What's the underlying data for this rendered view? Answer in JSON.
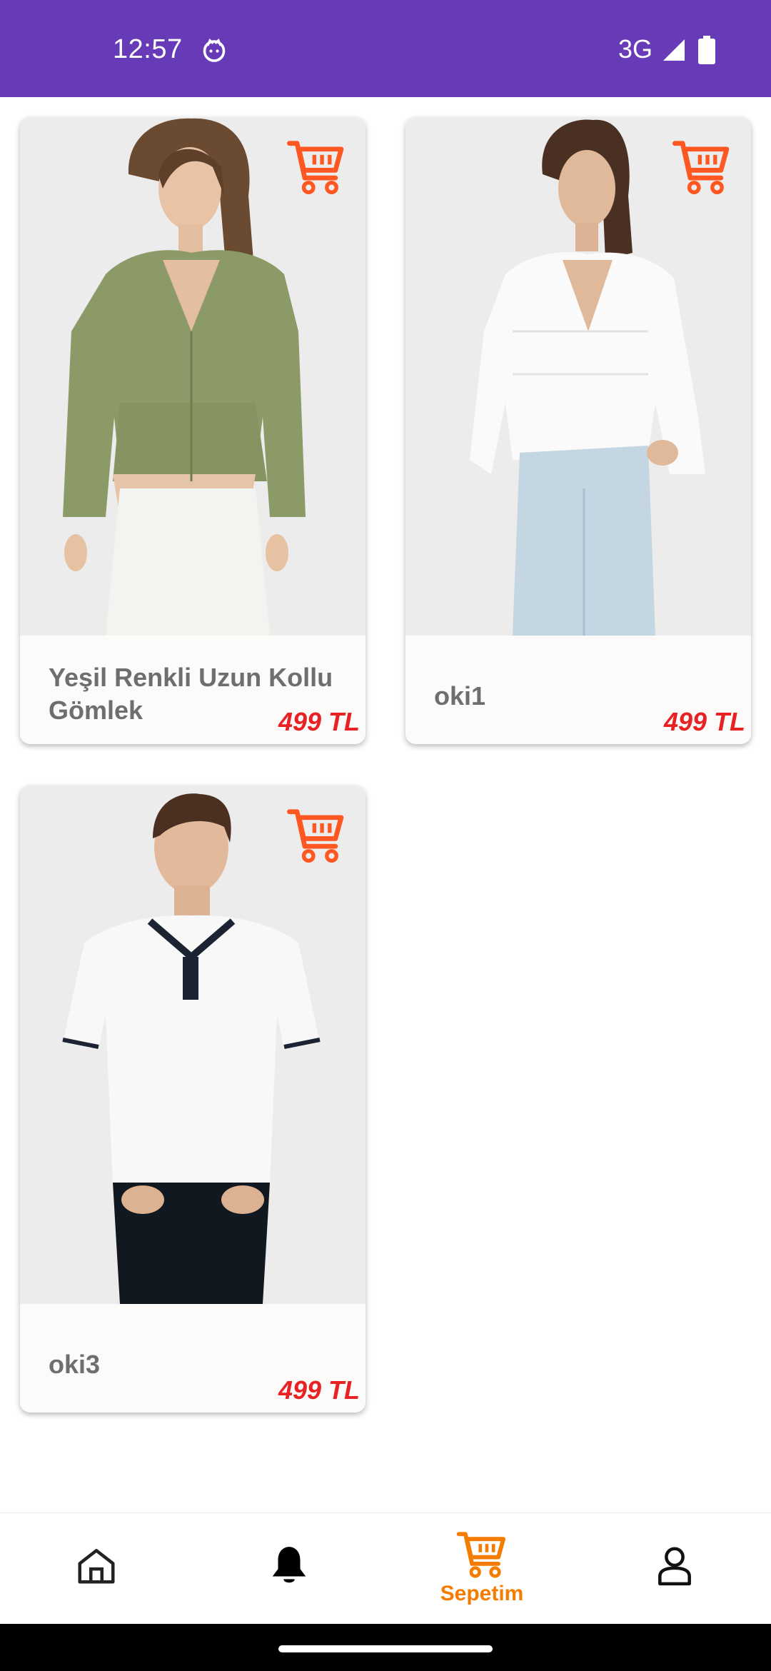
{
  "status_bar": {
    "time": "12:57",
    "network": "3G",
    "icons": [
      "cat-icon",
      "signal-icon",
      "battery-icon"
    ]
  },
  "products": [
    {
      "name": "Yeşil Renkli Uzun Kollu Gömlek",
      "price": "499 TL",
      "cart_icon": "cart-icon",
      "image": "woman in green blouse and white jeans"
    },
    {
      "name": "oki1",
      "price": "499 TL",
      "cart_icon": "cart-icon",
      "image": "woman in white blouse and blue jeans"
    },
    {
      "name": "oki3",
      "price": "499 TL",
      "cart_icon": "cart-icon",
      "image": "man in white polo shirt and black trousers"
    }
  ],
  "bottom_nav": {
    "items": [
      {
        "icon": "home-icon",
        "label": ""
      },
      {
        "icon": "bell-icon",
        "label": ""
      },
      {
        "icon": "cart-icon",
        "label": "Sepetim",
        "active": true
      },
      {
        "icon": "profile-icon",
        "label": ""
      }
    ]
  },
  "colors": {
    "status_bar": "#673ab7",
    "accent": "#f57c00",
    "cart_icon": "#ff5722",
    "price": "#e82222",
    "product_name": "#6e6e6e"
  }
}
